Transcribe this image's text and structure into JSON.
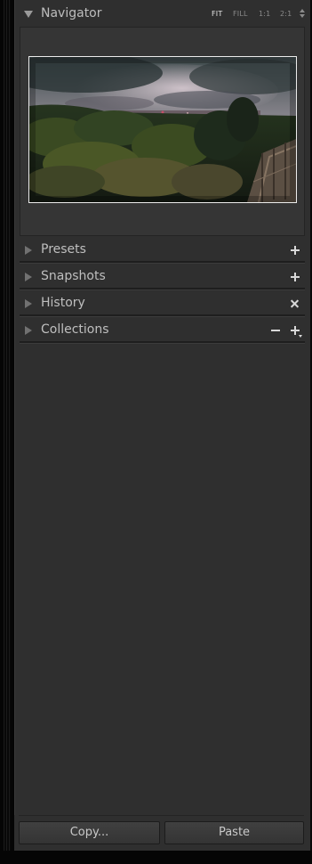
{
  "navigator": {
    "title": "Navigator",
    "zoom_options": {
      "fit": "FIT",
      "fill": "FILL",
      "one_to_one": "1:1",
      "two_to_one": "2:1"
    },
    "active_zoom": "FIT"
  },
  "sections": [
    {
      "label": "Presets",
      "action_icon": "plus-icon"
    },
    {
      "label": "Snapshots",
      "action_icon": "plus-icon"
    },
    {
      "label": "History",
      "action_icon": "close-icon"
    },
    {
      "label": "Collections",
      "action_icons": [
        "minus-icon",
        "plus-dropdown-icon"
      ]
    }
  ],
  "buttons": {
    "copy": "Copy...",
    "paste": "Paste"
  },
  "colors": {
    "panel_bg": "#2f2f2f",
    "text": "#bfbfbf",
    "active_zoom": "#e6e6e6"
  }
}
